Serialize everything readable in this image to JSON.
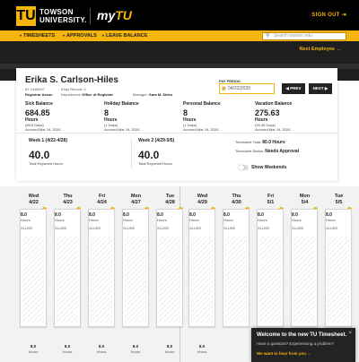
{
  "header": {
    "logo_mark": "TU",
    "logo_line1": "TOWSON",
    "logo_line2": "UNIVERSITY.",
    "app_brand_prefix": "my",
    "app_brand_suffix": "TU",
    "signout": "SIGN OUT",
    "signout_icon": "signout-arrow-icon"
  },
  "nav": {
    "items": [
      "TIMESHEETS",
      "APPROVALS",
      "LEAVE BALANCE"
    ],
    "search_placeholder": "Search towson.edu"
  },
  "next_employee": "Next Employee →",
  "employee": {
    "name": "Erika S. Carlson-Hiles",
    "id_label": "ID:",
    "id_value": "0165097",
    "empl_record": "Empl Record: 0",
    "registrar": "Registrar Assoc",
    "department_label": "Department:",
    "department": "Office of Registrar",
    "manager_label": "Manager:",
    "manager": "Sara M. Sides"
  },
  "pay_period": {
    "label": "PAY PERIOD",
    "value": "04/22/2020",
    "prev": "◀ PREV",
    "next": "NEXT ▶"
  },
  "balances": [
    {
      "title": "Sick Balance",
      "value": "684.85",
      "unit": "Hours",
      "days": "(85.6 Days)",
      "accrued": "Accrued Mar 24, 2020"
    },
    {
      "title": "Holiday Balance",
      "value": "8",
      "unit": "Hours",
      "days": "(1 Days)",
      "accrued": "Accrued Mar 24, 2020"
    },
    {
      "title": "Personal Balance",
      "value": "8",
      "unit": "Hours",
      "days": "(1 Days)",
      "accrued": "Accrued Mar 24, 2020"
    },
    {
      "title": "Vacation Balance",
      "value": "275.63",
      "unit": "Hours",
      "days": "(34.45 Days)",
      "accrued": "Accrued Mar 24, 2020"
    }
  ],
  "weeks": [
    {
      "title": "Week 1 (4/22-4/28)",
      "value": "40.0",
      "label": "Total Reported Hours"
    },
    {
      "title": "Week 2 (4/29-5/5)",
      "value": "40.0",
      "label": "Total Reported Hours"
    }
  ],
  "totals": {
    "total_label": "Timesheet Total:",
    "total_value": "80.0 Hours",
    "status_label": "Timesheet Status:",
    "status_value": "Needs Approval",
    "show_weekends": "Show Weekends"
  },
  "days": [
    {
      "dow": "Wed",
      "date": "4/22",
      "hours": "8.0",
      "label": "Hours",
      "code": "SLUSE"
    },
    {
      "dow": "Thu",
      "date": "4/23",
      "hours": "8.0",
      "label": "Hours",
      "code": "SLUSE"
    },
    {
      "dow": "Fri",
      "date": "4/24",
      "hours": "8.0",
      "label": "Hours",
      "code": "SLUSE"
    },
    {
      "dow": "Mon",
      "date": "4/27",
      "hours": "8.0",
      "label": "Hours",
      "code": "SLUSE"
    },
    {
      "dow": "Tue",
      "date": "4/28",
      "hours": "8.0",
      "label": "Hours",
      "code": "SLUSE"
    },
    {
      "dow": "Wed",
      "date": "4/29",
      "hours": "8.0",
      "label": "Hours",
      "code": "SLUSE"
    },
    {
      "dow": "Thu",
      "date": "4/30",
      "hours": "8.0",
      "label": "Hours",
      "code": "SLUSE"
    },
    {
      "dow": "Fri",
      "date": "5/1",
      "hours": "8.0",
      "label": "Hours",
      "code": "SLUSE"
    },
    {
      "dow": "Mon",
      "date": "5/4",
      "hours": "8.0",
      "label": "Hours",
      "code": "SLUSE"
    },
    {
      "dow": "Tue",
      "date": "5/5",
      "hours": "8.0",
      "label": "Hours",
      "code": "SLUSE"
    }
  ],
  "bottom_rows": [
    {
      "hours": "8.0",
      "label": "Hours"
    },
    {
      "hours": "8.0",
      "label": "Hours"
    },
    {
      "hours": "8.0",
      "label": "Hours"
    },
    {
      "hours": "8.0",
      "label": "Hours"
    },
    {
      "hours": "8.0",
      "label": "Hours"
    },
    {
      "hours": "8.0",
      "label": "Hours"
    }
  ],
  "toast": {
    "title": "Welcome to the new TU Timesheet.",
    "body": "Have a question? Experiencing a problem?",
    "link": "We want to hear from you →",
    "close": "×"
  }
}
